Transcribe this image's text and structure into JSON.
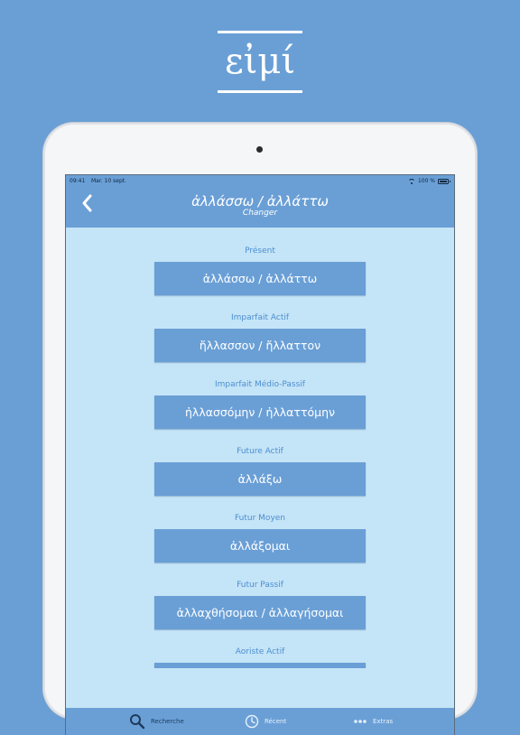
{
  "app_logo": {
    "word": "εἰμί"
  },
  "status_bar": {
    "time": "09:41",
    "date": "Mar. 10 sept.",
    "battery": "100 %"
  },
  "nav": {
    "title": "ἀλλάσσω / ἀλλάττω",
    "subtitle": "Changer"
  },
  "forms": [
    {
      "label": "Présent",
      "value": "ἀλλάσσω / ἀλλάττω"
    },
    {
      "label": "Imparfait Actif",
      "value": "ἤλλασσον / ἤλλαττον"
    },
    {
      "label": "Imparfait Médio-Passif",
      "value": "ἠλλασσόμην / ἠλλαττόμην"
    },
    {
      "label": "Future Actif",
      "value": "ἀλλάξω"
    },
    {
      "label": "Futur Moyen",
      "value": "ἀλλάξομαι"
    },
    {
      "label": "Futur Passif",
      "value": "ἀλλαχθήσομαι / ἀλλαγήσομαι"
    },
    {
      "label": "Aoriste Actif",
      "value": ""
    }
  ],
  "tab_bar": {
    "tabs": [
      {
        "label": "Recherche",
        "icon": "search-icon",
        "selected": true
      },
      {
        "label": "Récent",
        "icon": "clock-icon",
        "selected": false
      },
      {
        "label": "Extras",
        "icon": "more-icon",
        "selected": false
      }
    ]
  },
  "colors": {
    "background": "#6a9fd6",
    "screen": "#c4e4f7",
    "label": "#4d8fd0",
    "button": "#6a9fd6"
  }
}
